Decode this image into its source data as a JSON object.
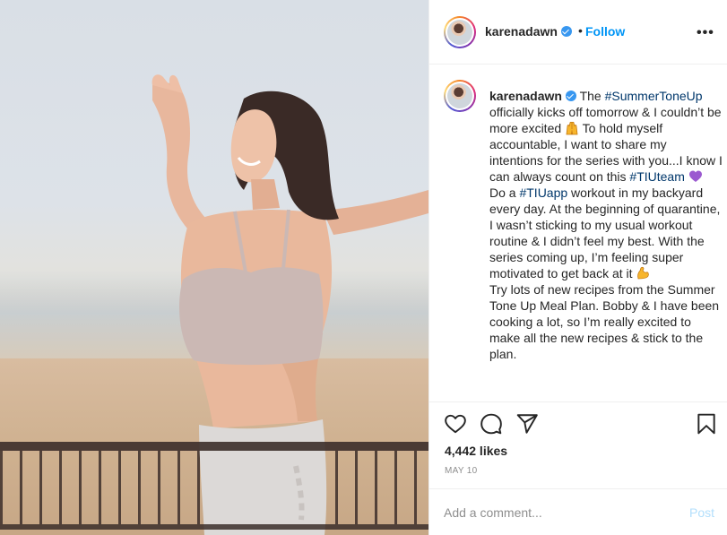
{
  "post": {
    "username": "karenadawn",
    "follow_label": "Follow",
    "dot": "•",
    "more_label": "•••",
    "likes": "4,442 likes",
    "date": "MAY 10"
  },
  "caption": {
    "username": "karenadawn",
    "t1": " The ",
    "h1": "#SummerToneUp",
    "t2": " officially kicks off tomorrow & I couldn’t be more excited ",
    "t3": " To hold myself accountable, I want to share my intentions for the series with you...I know I can always count on this ",
    "h2": "#TIUteam",
    "t4": "Do a ",
    "h3": "#TIUapp",
    "t5": " workout in my backyard every day. At the beginning of quarantine, I wasn’t sticking to my usual workout routine & I didn’t feel my best. With the series coming up, I’m feeling super motivated to get back at it ",
    "t6": "Try lots of new recipes from the Summer Tone Up Meal Plan. Bobby & I have been cooking a lot, so I’m really excited to make all the new recipes & stick to the plan."
  },
  "comment": {
    "placeholder": "Add a comment...",
    "post_label": "Post"
  },
  "icons": [
    "heart-icon",
    "comment-icon",
    "share-icon",
    "bookmark-icon",
    "verified-icon",
    "raised-hands-emoji",
    "purple-heart-emoji",
    "flexed-biceps-emoji"
  ],
  "colors": {
    "link": "#0095f6",
    "hashtag": "#00376b",
    "verified": "#3897f0",
    "border": "#efefef",
    "muted": "#8e8e8e",
    "post_disabled": "#b2dffc"
  }
}
